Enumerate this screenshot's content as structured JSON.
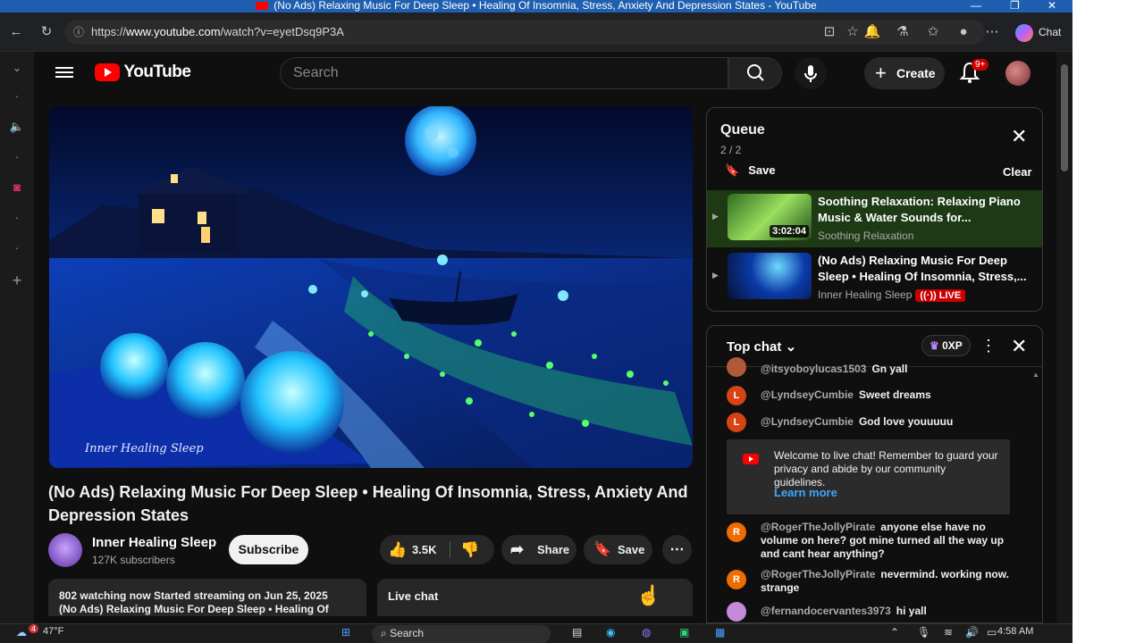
{
  "window": {
    "title": "(No Ads) Relaxing Music For Deep Sleep • Healing Of Insomnia, Stress, Anxiety And Depression States - YouTube"
  },
  "browser": {
    "url_prefix": "https://",
    "url_domain": "www.youtube.com",
    "url_path": "/watch?v=eyetDsq9P3A",
    "chat_label": "Chat"
  },
  "youtube": {
    "logo_text": "YouTube",
    "search_placeholder": "Search",
    "create_label": "Create",
    "notif_count": "9+"
  },
  "video": {
    "watermark": "Inner Healing Sleep",
    "title": "(No Ads) Relaxing Music For Deep Sleep • Healing Of Insomnia, Stress, Anxiety And Depression States",
    "channel_name": "Inner Healing Sleep",
    "subscribers": "127K subscribers",
    "subscribe_label": "Subscribe",
    "likes": "3.5K",
    "share_label": "Share",
    "save_label": "Save",
    "desc_line1": "802 watching now  Started streaming on Jun 25, 2025",
    "desc_line2": "(No Ads) Relaxing Music For Deep Sleep • Healing Of",
    "live_chat_label": "Live chat"
  },
  "queue": {
    "title": "Queue",
    "count": "2 / 2",
    "save_label": "Save",
    "clear_label": "Clear",
    "items": [
      {
        "title": "Soothing Relaxation: Relaxing Piano Music & Water Sounds for...",
        "channel": "Soothing Relaxation",
        "duration": "3:02:04"
      },
      {
        "title": "(No Ads) Relaxing Music For Deep Sleep • Healing Of Insomnia, Stress,...",
        "channel": "Inner Healing Sleep",
        "badge": "LIVE"
      }
    ]
  },
  "chat": {
    "header": "Top chat",
    "xp": "0XP",
    "messages": [
      {
        "author": "@itsyoboylucas1503",
        "text": "Gn yall",
        "initial": "",
        "color": "#b05a3a"
      },
      {
        "author": "@LyndseyCumbie",
        "text": "Sweet dreams",
        "initial": "L",
        "color": "#d84315"
      },
      {
        "author": "@LyndseyCumbie",
        "text": "God love youuuuu",
        "initial": "L",
        "color": "#d84315"
      },
      {
        "author": "@RogerTheJollyPirate",
        "text": "anyone else have no volume on here? got mine turned all the way up and cant hear anything?",
        "initial": "R",
        "color": "#ef6c00"
      },
      {
        "author": "@RogerTheJollyPirate",
        "text": "nevermind. working now. strange",
        "initial": "R",
        "color": "#ef6c00"
      },
      {
        "author": "@fernandocervantes3973",
        "text": "hi yall",
        "initial": "",
        "color": "#c28ad8"
      }
    ],
    "welcome": "Welcome to live chat! Remember to guard your privacy and abide by our community guidelines.",
    "learn_more": "Learn more"
  },
  "taskbar": {
    "temp": "47°F",
    "weather_badge": "4",
    "search_label": "Search",
    "time": "4:58 AM"
  },
  "colors": {
    "accent_red": "#ff0000",
    "link_blue": "#3ea6ff",
    "bg": "#0f0f0f"
  }
}
